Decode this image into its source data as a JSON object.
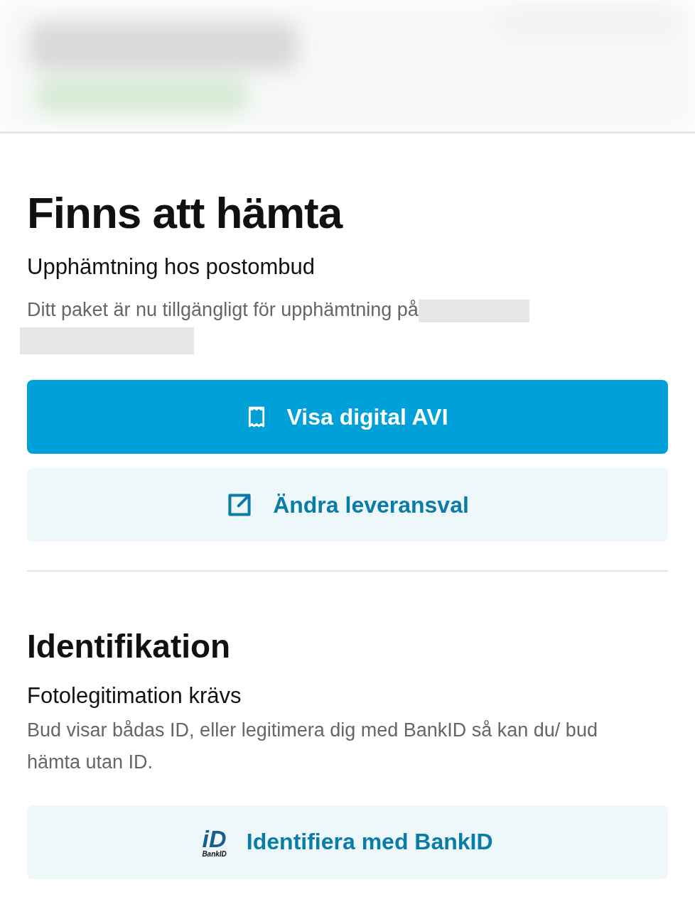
{
  "pickup": {
    "heading": "Finns att hämta",
    "subheading": "Upphämtning hos postombud",
    "description": "Ditt paket är nu tillgängligt för upphämtning på",
    "buttons": [
      {
        "label": "Visa digital AVI",
        "kind": "avi"
      },
      {
        "label": "Ändra leveransval",
        "kind": "delivery"
      }
    ]
  },
  "identification": {
    "heading": "Identifikation",
    "subheading": "Fotolegitimation krävs",
    "description": "Bud visar bådas ID, eller legitimera dig med BankID så kan du/ bud hämta utan ID.",
    "button": {
      "label": "Identifiera med BankID",
      "kind": "bankid",
      "logo_mark": "iD",
      "logo_caption": "BankID"
    }
  }
}
